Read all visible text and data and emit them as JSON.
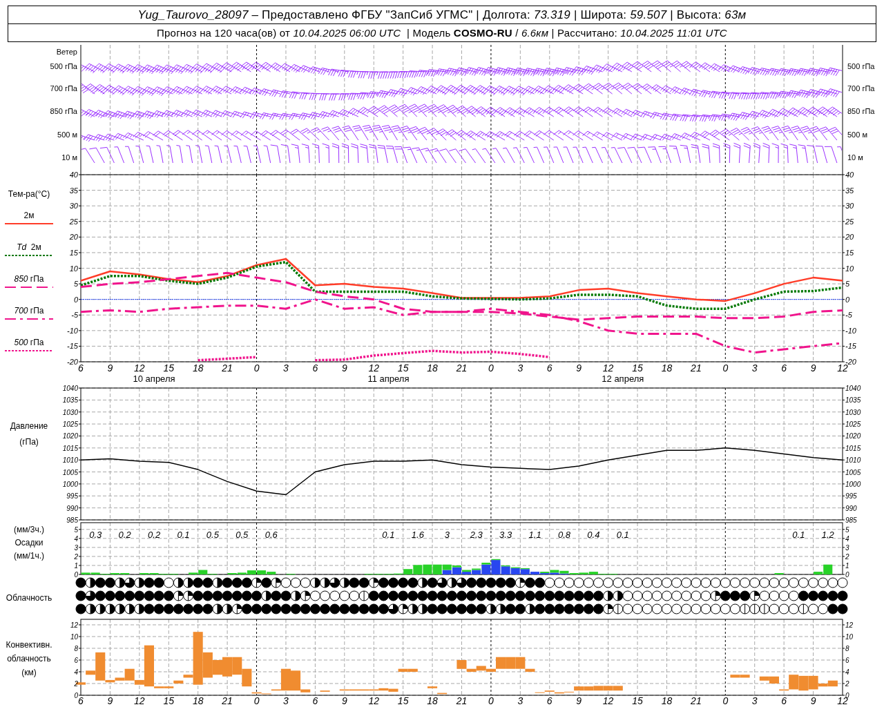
{
  "header": {
    "line1": "*Yug_Taurovo_28097* – Предоставлено ФГБУ \"ЗапСиб УГМС\" | Долгота: *73.319* | Широта: *59.507* | Высота: *63м*",
    "line2": "Прогноз на 120 часа(ов) от *10.04.2025 06:00 UTC*  | Модель **COSMO-RU** / *6.6км* | Рассчитано: *10.04.2025 11:01 UTC*"
  },
  "wind": {
    "title": "Ветер",
    "levels_left": [
      "500 гПа",
      "700 гПа",
      "850 гПа",
      "500 м",
      "10 м"
    ],
    "levels_right": [
      "500 гПа",
      "700 гПа",
      "850 гПа",
      "500 м",
      "10 м"
    ]
  },
  "temperature": {
    "title": "Тем-ра(°C)",
    "dates": [
      "10 апреля",
      "11 апреля",
      "12 апреля"
    ],
    "right_ticks": [
      "40",
      "35",
      "30",
      "25",
      "20",
      "15",
      "10",
      "5",
      "0",
      "-5",
      "-10",
      "-15",
      "-20"
    ],
    "chart_data": {
      "type": "line",
      "categories": [
        "6",
        "9",
        "12",
        "15",
        "18",
        "21",
        "0",
        "3",
        "6",
        "9",
        "12",
        "15",
        "18",
        "21",
        "0",
        "3",
        "6",
        "9",
        "12",
        "15",
        "18",
        "21",
        "0",
        "3",
        "6",
        "9",
        "12"
      ],
      "ylim": [
        -20,
        40
      ],
      "grid": true,
      "ref_lines": [
        {
          "axis": "y",
          "value": 0,
          "color": "#2040ff"
        }
      ],
      "yticks": [
        -20,
        -15,
        -10,
        -5,
        0,
        5,
        10,
        15,
        20,
        25,
        30,
        35,
        40
      ],
      "series": [
        {
          "name": "2м",
          "color": "#ff3c28",
          "line_style": "solid",
          "values": [
            6,
            9,
            8,
            6.5,
            5.5,
            7.5,
            11,
            13,
            4.5,
            5,
            4,
            3.5,
            2,
            0.5,
            0.5,
            0.5,
            1,
            3,
            3.5,
            2,
            1,
            0,
            -0.5,
            2,
            5,
            7,
            6
          ]
        },
        {
          "name": "*Td*  2м",
          "color": "#007800",
          "line_style": "dotted",
          "values": [
            4.5,
            7.5,
            7.5,
            6,
            5,
            7,
            10.5,
            12,
            2.5,
            2.5,
            2.5,
            2.5,
            1,
            0.3,
            0.2,
            0,
            0.3,
            1.5,
            1.5,
            1,
            -2,
            -3,
            -3,
            0,
            2.5,
            2.7,
            3.8
          ]
        },
        {
          "name": "*850* гПа",
          "color": "#f0148c",
          "line_style": "dashed",
          "values": [
            4,
            5,
            5.5,
            6.5,
            7.5,
            8.5,
            7,
            5.5,
            2.5,
            1,
            0,
            -3,
            -4,
            -4,
            -4,
            -4.5,
            -5.5,
            -6.5,
            -6,
            -5.5,
            -5.5,
            -5.5,
            -6,
            -6,
            -5.5,
            -4,
            -3.5
          ]
        },
        {
          "name": "*700* гПа",
          "color": "#f0148c",
          "line_style": "dashdot",
          "values": [
            -4,
            -3.5,
            -4,
            -3,
            -2.5,
            -2,
            -2,
            -3,
            0,
            -3,
            -2.5,
            -5,
            -4,
            -4,
            -3,
            -4,
            -5,
            -7,
            -10,
            -11,
            -11,
            -11,
            -15,
            -17,
            -16,
            -15,
            -14
          ]
        },
        {
          "name": "*500* гПа",
          "color": "#f0148c",
          "line_style": "dotted",
          "values": [
            null,
            null,
            null,
            null,
            -19.5,
            -19,
            -18.5,
            null,
            -19.5,
            -19.3,
            -18,
            -17.2,
            -16.5,
            -17,
            -16.8,
            -17.5,
            -18.5,
            null,
            null,
            null,
            null,
            null,
            null,
            null,
            null,
            null,
            null
          ]
        }
      ]
    }
  },
  "pressure": {
    "title": "Давление",
    "unit": "(гПа)",
    "right_ticks": [
      "1040",
      "1035",
      "1030",
      "1025",
      "1020",
      "1015",
      "1010",
      "1005",
      "1000",
      "995",
      "990",
      "985"
    ],
    "chart_data": {
      "type": "line",
      "categories": [
        null,
        null,
        null,
        null,
        null,
        null,
        null,
        null,
        null,
        null,
        null,
        null,
        null,
        null,
        null,
        null,
        null,
        null,
        null,
        null,
        null,
        null,
        null,
        null,
        null,
        null,
        null
      ],
      "ylim": [
        985,
        1040
      ],
      "grid": true,
      "yticks": [
        985,
        990,
        995,
        1000,
        1005,
        1010,
        1015,
        1020,
        1025,
        1030,
        1035,
        1040
      ],
      "series": [
        {
          "color": "#000000",
          "line_style": "solid",
          "values": [
            1010,
            1010.5,
            1009.5,
            1009,
            1006,
            1001,
            997,
            995.5,
            1005,
            1008,
            1009.5,
            1009.5,
            1010,
            1008,
            1007,
            1006.5,
            1006,
            1007.5,
            1010,
            1012,
            1014,
            1014,
            1015,
            1014,
            1012.5,
            1011,
            1010
          ]
        }
      ]
    }
  },
  "precipitation": {
    "labels": [
      "(мм/3ч.)",
      "Осадки",
      "(мм/1ч.)"
    ],
    "right_ticks": [
      "5",
      "4",
      "3",
      "2",
      "1",
      "0"
    ],
    "totals": [
      {
        "kind": "total",
        "text": "0.3"
      },
      {
        "kind": "total",
        "text": "0.2"
      },
      {
        "kind": "total",
        "text": "0.2"
      },
      {
        "kind": "total",
        "text": "0.1"
      },
      {
        "kind": "total",
        "text": "0.5"
      },
      {
        "kind": "total",
        "text": "0.5"
      },
      {
        "kind": "total",
        "text": "0.6"
      },
      {
        "kind": "none"
      },
      {
        "kind": "none"
      },
      {
        "kind": "none"
      },
      {
        "kind": "total",
        "text": "0.1"
      },
      {
        "kind": "total",
        "text": "1.6"
      },
      {
        "kind": "total",
        "text": "3"
      },
      {
        "kind": "total",
        "text": "2.3"
      },
      {
        "kind": "total",
        "text": "3.3"
      },
      {
        "kind": "total",
        "text": "1.1"
      },
      {
        "kind": "total",
        "text": "0.8"
      },
      {
        "kind": "total",
        "text": "0.4"
      },
      {
        "kind": "total",
        "text": "0.1"
      },
      {
        "kind": "none"
      },
      {
        "kind": "none"
      },
      {
        "kind": "none"
      },
      {
        "kind": "none"
      },
      {
        "kind": "none"
      },
      {
        "kind": "total",
        "text": "0.1"
      },
      {
        "kind": "total",
        "text": "1.2"
      }
    ],
    "chart_data": {
      "type": "bar",
      "stacked": true,
      "grid": true,
      "categories": [
        null,
        null,
        null,
        null,
        null,
        null,
        null,
        null,
        null,
        null,
        null,
        null,
        null,
        null,
        null,
        null,
        null,
        null,
        null,
        null,
        null,
        null,
        null,
        null,
        null,
        null,
        null,
        null,
        null,
        null,
        null,
        null,
        null,
        null,
        null,
        null,
        null,
        null,
        null,
        null,
        null,
        null,
        null,
        null,
        null,
        null,
        null,
        null,
        null,
        null,
        null,
        null,
        null,
        null,
        null,
        null,
        null,
        null,
        null,
        null,
        null,
        null,
        null,
        null,
        null,
        null,
        null,
        null,
        null,
        null,
        null,
        null,
        null,
        null,
        null,
        null,
        null,
        null
      ],
      "ylim": [
        0,
        5.75
      ],
      "yticks": [
        0,
        1,
        2,
        3,
        4,
        5
      ],
      "series": [
        {
          "color": "#2846f0",
          "values": [
            0,
            0,
            0,
            0,
            0,
            0,
            0,
            0,
            0,
            0,
            0,
            0,
            0,
            0,
            0,
            0,
            0,
            0,
            0,
            0,
            0,
            0,
            0,
            0,
            0,
            0,
            0,
            0,
            0,
            0,
            0,
            0,
            0,
            0,
            0,
            0,
            0,
            0.5,
            0.8,
            0.3,
            0.5,
            1.1,
            1.6,
            0.9,
            0.7,
            0.6,
            0.3,
            0.15,
            0.2,
            0.1,
            0,
            0,
            0,
            0,
            0,
            0,
            0,
            0,
            0,
            0,
            0,
            0,
            0,
            0,
            0,
            0,
            0,
            0,
            0,
            0,
            0,
            0,
            0,
            0,
            0,
            0,
            0,
            0
          ]
        },
        {
          "color": "#28d228",
          "values": [
            0.2,
            0.2,
            0.05,
            0.15,
            0.15,
            0,
            0.15,
            0.15,
            0.05,
            0.05,
            0,
            0.2,
            0.5,
            0.05,
            0,
            0.15,
            0.2,
            0.45,
            0.45,
            0.3,
            0,
            0.05,
            0,
            0,
            0,
            0,
            0,
            0,
            0,
            0.05,
            0.05,
            0.05,
            0.1,
            0.6,
            1.05,
            1.1,
            1.1,
            0.6,
            0.2,
            0.2,
            0.15,
            0.2,
            0.1,
            0.1,
            0.1,
            0.1,
            0,
            0.15,
            0.3,
            0.3,
            0.15,
            0.2,
            0.3,
            0.05,
            0.05,
            0,
            0,
            0,
            0,
            0,
            0,
            0,
            0,
            0,
            0,
            0,
            0,
            0,
            0,
            0,
            0,
            0.15,
            0,
            0,
            0,
            0.3,
            1.1,
            0
          ]
        }
      ]
    }
  },
  "clouds": {
    "title": "Облачность",
    "rows": [
      {
        "cells": [
          {
            "kind": "overcast"
          },
          {
            "kind": "half"
          },
          {
            "kind": "overcast"
          },
          {
            "kind": "overcast"
          },
          {
            "kind": "half"
          },
          {
            "kind": "most"
          },
          {
            "kind": "half"
          },
          {
            "kind": "overcast"
          },
          {
            "kind": "overcast"
          },
          {
            "kind": "clear"
          },
          {
            "kind": "half"
          },
          {
            "kind": "half"
          },
          {
            "kind": "overcast"
          },
          {
            "kind": "overcast"
          },
          {
            "kind": "half"
          },
          {
            "kind": "overcast"
          },
          {
            "kind": "overcast"
          },
          {
            "kind": "overcast"
          },
          {
            "kind": "quarter"
          },
          {
            "kind": "overcast"
          },
          {
            "kind": "quarter"
          },
          {
            "kind": "clear"
          },
          {
            "kind": "clear"
          },
          {
            "kind": "clear"
          },
          {
            "kind": "half"
          },
          {
            "kind": "half"
          },
          {
            "kind": "most"
          },
          {
            "kind": "half"
          },
          {
            "kind": "overcast"
          },
          {
            "kind": "overcast"
          },
          {
            "kind": "quarter"
          },
          {
            "kind": "overcast"
          },
          {
            "kind": "overcast"
          },
          {
            "kind": "overcast"
          },
          {
            "kind": "overcast"
          },
          {
            "kind": "half"
          },
          {
            "kind": "overcast"
          },
          {
            "kind": "most"
          },
          {
            "kind": "half"
          },
          {
            "kind": "most"
          },
          {
            "kind": "overcast"
          },
          {
            "kind": "overcast"
          },
          {
            "kind": "overcast"
          },
          {
            "kind": "overcast"
          },
          {
            "kind": "overcast"
          },
          {
            "kind": "quarter"
          },
          {
            "kind": "overcast"
          },
          {
            "kind": "overcast"
          },
          {
            "kind": "clear"
          },
          {
            "kind": "clear"
          },
          {
            "kind": "clear"
          },
          {
            "kind": "clear"
          },
          {
            "kind": "clear"
          },
          {
            "kind": "clear"
          },
          {
            "kind": "clear"
          },
          {
            "kind": "clear"
          },
          {
            "kind": "clear"
          },
          {
            "kind": "clear"
          },
          {
            "kind": "clear"
          },
          {
            "kind": "clear"
          },
          {
            "kind": "clear"
          },
          {
            "kind": "clear"
          },
          {
            "kind": "clear"
          },
          {
            "kind": "clear"
          },
          {
            "kind": "clear"
          },
          {
            "kind": "clear"
          },
          {
            "kind": "clear"
          },
          {
            "kind": "clear"
          },
          {
            "kind": "clear"
          },
          {
            "kind": "clear"
          },
          {
            "kind": "clear"
          },
          {
            "kind": "clear"
          },
          {
            "kind": "clear"
          },
          {
            "kind": "clear"
          },
          {
            "kind": "clear"
          },
          {
            "kind": "clear"
          },
          {
            "kind": "clear"
          },
          {
            "kind": "clear"
          },
          {
            "kind": "clear"
          }
        ]
      },
      {
        "cells": [
          {
            "kind": "overcast"
          },
          {
            "kind": "most"
          },
          {
            "kind": "overcast"
          },
          {
            "kind": "overcast"
          },
          {
            "kind": "overcast"
          },
          {
            "kind": "overcast"
          },
          {
            "kind": "overcast"
          },
          {
            "kind": "overcast"
          },
          {
            "kind": "overcast"
          },
          {
            "kind": "overcast"
          },
          {
            "kind": "quarter"
          },
          {
            "kind": "quarter"
          },
          {
            "kind": "overcast"
          },
          {
            "kind": "overcast"
          },
          {
            "kind": "overcast"
          },
          {
            "kind": "overcast"
          },
          {
            "kind": "overcast"
          },
          {
            "kind": "overcast"
          },
          {
            "kind": "overcast"
          },
          {
            "kind": "half"
          },
          {
            "kind": "overcast"
          },
          {
            "kind": "overcast"
          },
          {
            "kind": "half"
          },
          {
            "kind": "quarter"
          },
          {
            "kind": "clear"
          },
          {
            "kind": "clear"
          },
          {
            "kind": "clear"
          },
          {
            "kind": "clear"
          },
          {
            "kind": "clear"
          },
          {
            "kind": "few"
          },
          {
            "kind": "overcast"
          },
          {
            "kind": "overcast"
          },
          {
            "kind": "overcast"
          },
          {
            "kind": "overcast"
          },
          {
            "kind": "overcast"
          },
          {
            "kind": "overcast"
          },
          {
            "kind": "overcast"
          },
          {
            "kind": "overcast"
          },
          {
            "kind": "overcast"
          },
          {
            "kind": "overcast"
          },
          {
            "kind": "overcast"
          },
          {
            "kind": "overcast"
          },
          {
            "kind": "overcast"
          },
          {
            "kind": "overcast"
          },
          {
            "kind": "overcast"
          },
          {
            "kind": "overcast"
          },
          {
            "kind": "overcast"
          },
          {
            "kind": "overcast"
          },
          {
            "kind": "overcast"
          },
          {
            "kind": "overcast"
          },
          {
            "kind": "overcast"
          },
          {
            "kind": "overcast"
          },
          {
            "kind": "overcast"
          },
          {
            "kind": "overcast"
          },
          {
            "kind": "half"
          },
          {
            "kind": "half"
          },
          {
            "kind": "clear"
          },
          {
            "kind": "clear"
          },
          {
            "kind": "clear"
          },
          {
            "kind": "clear"
          },
          {
            "kind": "clear"
          },
          {
            "kind": "clear"
          },
          {
            "kind": "clear"
          },
          {
            "kind": "clear"
          },
          {
            "kind": "clear"
          },
          {
            "kind": "quarter"
          },
          {
            "kind": "overcast"
          },
          {
            "kind": "overcast"
          },
          {
            "kind": "overcast"
          },
          {
            "kind": "quarter"
          },
          {
            "kind": "clear"
          },
          {
            "kind": "clear"
          },
          {
            "kind": "clear"
          },
          {
            "kind": "clear"
          },
          {
            "kind": "overcast"
          },
          {
            "kind": "overcast"
          },
          {
            "kind": "overcast"
          },
          {
            "kind": "overcast"
          },
          {
            "kind": "overcast"
          }
        ]
      },
      {
        "cells": [
          {
            "kind": "overcast"
          },
          {
            "kind": "half"
          },
          {
            "kind": "half"
          },
          {
            "kind": "half"
          },
          {
            "kind": "half"
          },
          {
            "kind": "half"
          },
          {
            "kind": "half"
          },
          {
            "kind": "overcast"
          },
          {
            "kind": "overcast"
          },
          {
            "kind": "overcast"
          },
          {
            "kind": "overcast"
          },
          {
            "kind": "overcast"
          },
          {
            "kind": "overcast"
          },
          {
            "kind": "overcast"
          },
          {
            "kind": "half"
          },
          {
            "kind": "half"
          },
          {
            "kind": "quarter"
          },
          {
            "kind": "overcast"
          },
          {
            "kind": "overcast"
          },
          {
            "kind": "overcast"
          },
          {
            "kind": "overcast"
          },
          {
            "kind": "overcast"
          },
          {
            "kind": "overcast"
          },
          {
            "kind": "overcast"
          },
          {
            "kind": "overcast"
          },
          {
            "kind": "overcast"
          },
          {
            "kind": "overcast"
          },
          {
            "kind": "overcast"
          },
          {
            "kind": "overcast"
          },
          {
            "kind": "overcast"
          },
          {
            "kind": "overcast"
          },
          {
            "kind": "overcast"
          },
          {
            "kind": "most"
          },
          {
            "kind": "quarter"
          },
          {
            "kind": "half"
          },
          {
            "kind": "half"
          },
          {
            "kind": "overcast"
          },
          {
            "kind": "overcast"
          },
          {
            "kind": "overcast"
          },
          {
            "kind": "overcast"
          },
          {
            "kind": "overcast"
          },
          {
            "kind": "overcast"
          },
          {
            "kind": "half"
          },
          {
            "kind": "half"
          },
          {
            "kind": "overcast"
          },
          {
            "kind": "overcast"
          },
          {
            "kind": "half"
          },
          {
            "kind": "overcast"
          },
          {
            "kind": "overcast"
          },
          {
            "kind": "overcast"
          },
          {
            "kind": "overcast"
          },
          {
            "kind": "overcast"
          },
          {
            "kind": "overcast"
          },
          {
            "kind": "overcast"
          },
          {
            "kind": "quarter"
          },
          {
            "kind": "few"
          },
          {
            "kind": "clear"
          },
          {
            "kind": "clear"
          },
          {
            "kind": "clear"
          },
          {
            "kind": "clear"
          },
          {
            "kind": "clear"
          },
          {
            "kind": "clear"
          },
          {
            "kind": "clear"
          },
          {
            "kind": "clear"
          },
          {
            "kind": "clear"
          },
          {
            "kind": "clear"
          },
          {
            "kind": "clear"
          },
          {
            "kind": "clear"
          },
          {
            "kind": "few"
          },
          {
            "kind": "few"
          },
          {
            "kind": "few"
          },
          {
            "kind": "clear"
          },
          {
            "kind": "clear"
          },
          {
            "kind": "clear"
          },
          {
            "kind": "few"
          },
          {
            "kind": "clear"
          },
          {
            "kind": "clear"
          },
          {
            "kind": "overcast"
          },
          {
            "kind": "overcast"
          }
        ]
      }
    ]
  },
  "convective": {
    "labels": [
      "Конвективн.",
      "облачность",
      "(км)"
    ],
    "right_ticks": [
      "12",
      "10",
      "8",
      "6",
      "4",
      "2",
      "0"
    ],
    "chart_data": {
      "type": "candlestick",
      "grid": true,
      "categories": [
        "6",
        null,
        null,
        "9",
        null,
        null,
        "12",
        null,
        null,
        "15",
        null,
        null,
        "18",
        null,
        null,
        "21",
        null,
        null,
        "0",
        null,
        null,
        "3",
        null,
        null,
        "6",
        null,
        null,
        "9",
        null,
        null,
        "12",
        null,
        null,
        "15",
        null,
        null,
        "18",
        null,
        null,
        "21",
        null,
        null,
        "0",
        null,
        null,
        "3",
        null,
        null,
        "6",
        null,
        null,
        "9",
        null,
        null,
        "12",
        null,
        null,
        "15",
        null,
        null,
        "18",
        null,
        null,
        "21",
        null,
        null,
        "0",
        null,
        null,
        "3",
        null,
        null,
        "6",
        null,
        null,
        "9",
        null,
        null,
        "12"
      ],
      "ylim": [
        0,
        12.94
      ],
      "yticks": [
        0,
        2,
        4,
        6,
        8,
        10,
        12
      ],
      "series": [
        {
          "color": "#f08c30",
          "ohlc": [
            [
              1.8,
              2.2,
              1.8,
              2.2
            ],
            [
              3.5,
              4.2,
              3.5,
              4.2
            ],
            [
              2.5,
              7.3,
              2.5,
              7.3
            ],
            [
              2.2,
              2.6,
              2.2,
              2.6
            ],
            [
              2.5,
              3,
              2.5,
              3
            ],
            [
              2.5,
              4.5,
              2.5,
              4.5
            ],
            [
              1.8,
              2.6,
              1.8,
              2.6
            ],
            [
              1.5,
              8.5,
              1.5,
              8.5
            ],
            [
              1.2,
              1.5,
              1.2,
              1.5
            ],
            [
              1.2,
              1.5,
              1.2,
              1.5
            ],
            [
              2,
              2.5,
              2,
              2.5
            ],
            [
              3,
              3.5,
              3,
              3.5
            ],
            [
              1.8,
              10.8,
              1.8,
              10.8
            ],
            [
              3,
              7.3,
              3,
              7.3
            ],
            [
              3.5,
              6,
              3.5,
              6
            ],
            [
              3.2,
              6.5,
              3.2,
              6.5
            ],
            [
              3.5,
              6.5,
              3.5,
              6.5
            ],
            [
              1.5,
              4.5,
              1.5,
              4.5
            ],
            [
              0.3,
              0.5,
              0.3,
              0.5
            ],
            [
              0.2,
              0.3,
              0.2,
              0.3
            ],
            [
              0.8,
              1,
              0.8,
              1
            ],
            [
              0.8,
              4.5,
              0.8,
              4.5
            ],
            [
              0.8,
              4.2,
              0.8,
              4.2
            ],
            [
              0.5,
              1,
              0.5,
              1
            ],
            null,
            [
              0.6,
              0.8,
              0.6,
              0.8
            ],
            null,
            [
              0.8,
              1,
              0.8,
              1
            ],
            [
              0.8,
              1,
              0.8,
              1
            ],
            [
              0.8,
              1,
              0.8,
              1
            ],
            [
              0.8,
              1,
              0.8,
              1
            ],
            [
              0.8,
              1.2,
              0.8,
              1.2
            ],
            [
              0.6,
              1.1,
              0.6,
              1.1
            ],
            [
              4,
              4.5,
              4,
              4.5
            ],
            [
              4,
              4.5,
              4,
              4.5
            ],
            null,
            [
              1.2,
              1.5,
              1.2,
              1.5
            ],
            [
              0.2,
              0.4,
              0.2,
              0.4
            ],
            null,
            [
              4.5,
              6,
              4.5,
              6
            ],
            [
              4,
              4.5,
              4,
              4.5
            ],
            [
              4.2,
              5,
              4.2,
              5
            ],
            [
              4,
              4.5,
              4,
              4.5
            ],
            [
              4.5,
              6.5,
              4.5,
              6.5
            ],
            [
              4.5,
              6.5,
              4.5,
              6.5
            ],
            [
              4.5,
              6.5,
              4.5,
              6.5
            ],
            [
              4,
              4.5,
              4,
              4.5
            ],
            [
              0.4,
              0.5,
              0.4,
              0.5
            ],
            [
              0.6,
              0.8,
              0.6,
              0.8
            ],
            [
              0.3,
              0.5,
              0.3,
              0.5
            ],
            [
              0.5,
              0.6,
              0.5,
              0.6
            ],
            [
              0.8,
              1.5,
              0.8,
              1.5
            ],
            [
              0.8,
              1.5,
              0.8,
              1.5
            ],
            [
              0.8,
              1.6,
              0.8,
              1.6
            ],
            [
              0.8,
              1.6,
              0.8,
              1.6
            ],
            [
              0.8,
              1.6,
              0.8,
              1.6
            ],
            null,
            null,
            null,
            null,
            null,
            null,
            null,
            null,
            null,
            null,
            null,
            [
              3,
              3.5,
              3,
              3.5
            ],
            [
              3,
              3.5,
              3,
              3.5
            ],
            null,
            [
              2.5,
              3.2,
              2.5,
              3.2
            ],
            [
              2,
              3.2,
              2,
              3.2
            ],
            [
              0.8,
              1,
              0.8,
              1
            ],
            [
              1,
              3.5,
              1,
              3.5
            ],
            [
              0.8,
              3.3,
              0.8,
              3.3
            ],
            [
              1,
              3.3,
              1,
              3.3
            ],
            [
              1.5,
              2,
              1.5,
              2
            ],
            [
              1.5,
              2.5,
              1.5,
              2.5
            ],
            null
          ]
        }
      ]
    }
  }
}
